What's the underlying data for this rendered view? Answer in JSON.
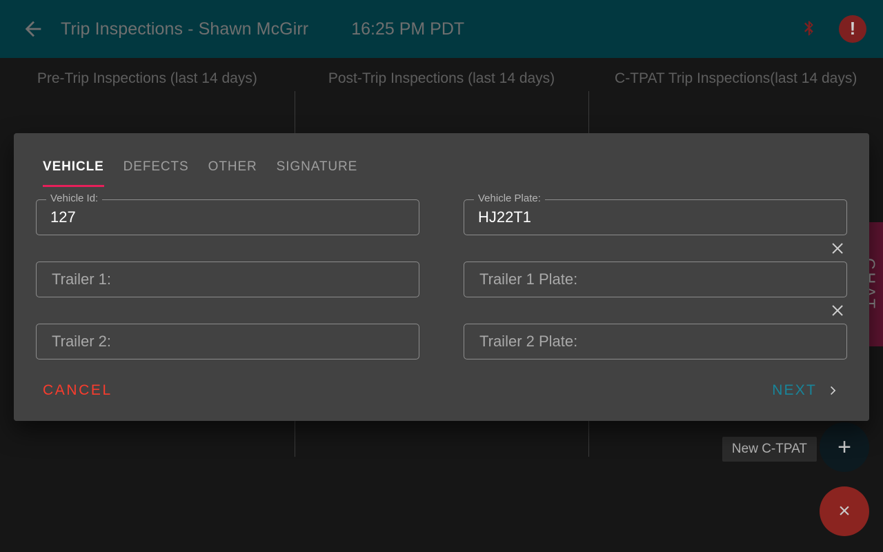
{
  "appbar": {
    "back_icon": "arrow-left-icon",
    "title": "Trip Inspections - Shawn McGirr",
    "time": "16:25 PM PDT",
    "bluetooth_icon": "bluetooth-icon",
    "alert_icon": "alert-exclamation-icon",
    "alert_glyph": "!",
    "background_color": "#023840",
    "alert_color": "#7e2020",
    "bluetooth_color": "#7e2020"
  },
  "columns": [
    {
      "title": "Pre-Trip Inspections (last 14 days)"
    },
    {
      "title": "Post-Trip Inspections (last 14 days)"
    },
    {
      "title": "C-TPAT Trip Inspections(last 14 days)"
    }
  ],
  "chat_tab": {
    "label": "CHAT",
    "color": "#5c1430"
  },
  "fabs": {
    "add_label": "New C-TPAT",
    "add_glyph": "+",
    "add_color": "#0c1a20",
    "close_glyph": "×",
    "close_color": "#8b2420"
  },
  "dialog": {
    "accent_color": "#e61f5a",
    "background_color": "#424242",
    "tabs": [
      {
        "label": "VEHICLE",
        "active": true
      },
      {
        "label": "DEFECTS",
        "active": false
      },
      {
        "label": "OTHER",
        "active": false
      },
      {
        "label": "SIGNATURE",
        "active": false
      }
    ],
    "fields": {
      "vehicle_id": {
        "label": "Vehicle Id:",
        "value": "127"
      },
      "vehicle_plate": {
        "label": "Vehicle Plate:",
        "value": "HJ22T1"
      },
      "trailer_1": {
        "placeholder": "Trailer 1:",
        "value": ""
      },
      "trailer_1_plate": {
        "placeholder": "Trailer 1 Plate:",
        "value": ""
      },
      "trailer_2": {
        "placeholder": "Trailer 2:",
        "value": ""
      },
      "trailer_2_plate": {
        "placeholder": "Trailer 2 Plate:",
        "value": ""
      }
    },
    "clear_icon": "close-x-icon",
    "actions": {
      "cancel_label": "CANCEL",
      "cancel_color": "#fa3c2d",
      "next_label": "NEXT",
      "next_color": "#18859a",
      "next_icon": "chevron-right-icon"
    }
  }
}
